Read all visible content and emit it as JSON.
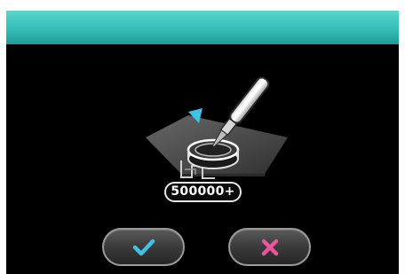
{
  "counter": {
    "value": "500000+"
  },
  "icons": {
    "confirm": "checkmark-icon",
    "cancel": "cross-icon",
    "illustration": "vacuum-pen-on-wafer-illustration",
    "pointer": "down-arrow-indicator-icon"
  },
  "colors": {
    "header": "#36bdb6",
    "confirm_icon": "#3ec3e6",
    "cancel_icon": "#e8559b",
    "background": "#000000"
  }
}
